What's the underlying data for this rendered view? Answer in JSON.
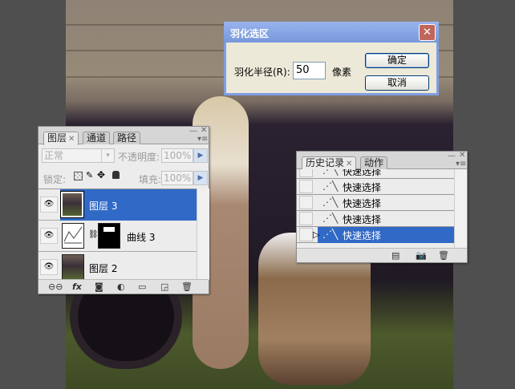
{
  "feather_dialog": {
    "title": "羽化选区",
    "label": "羽化半径(R):",
    "value": "50",
    "unit": "像素",
    "ok": "确定",
    "cancel": "取消"
  },
  "layers_panel": {
    "tabs": [
      {
        "label": "图层"
      },
      {
        "label": "通道"
      },
      {
        "label": "路径"
      }
    ],
    "blend_mode": "正常",
    "opacity_label": "不透明度:",
    "opacity": "100%",
    "lock_label": "锁定:",
    "fill_label": "填充:",
    "fill": "100%",
    "layers": [
      {
        "name": "图层 3",
        "selected": true
      },
      {
        "name": "曲线 3",
        "selected": false
      },
      {
        "name": "图层 2",
        "selected": false
      }
    ]
  },
  "history_panel": {
    "tabs": [
      {
        "label": "历史记录"
      },
      {
        "label": "动作"
      }
    ],
    "items": [
      {
        "label": "快速选择"
      },
      {
        "label": "快速选择"
      },
      {
        "label": "快速选择"
      },
      {
        "label": "快速选择"
      },
      {
        "label": "快速选择",
        "selected": true
      }
    ]
  },
  "colors": {
    "selection": "#3169c6",
    "panel": "#ececec"
  }
}
